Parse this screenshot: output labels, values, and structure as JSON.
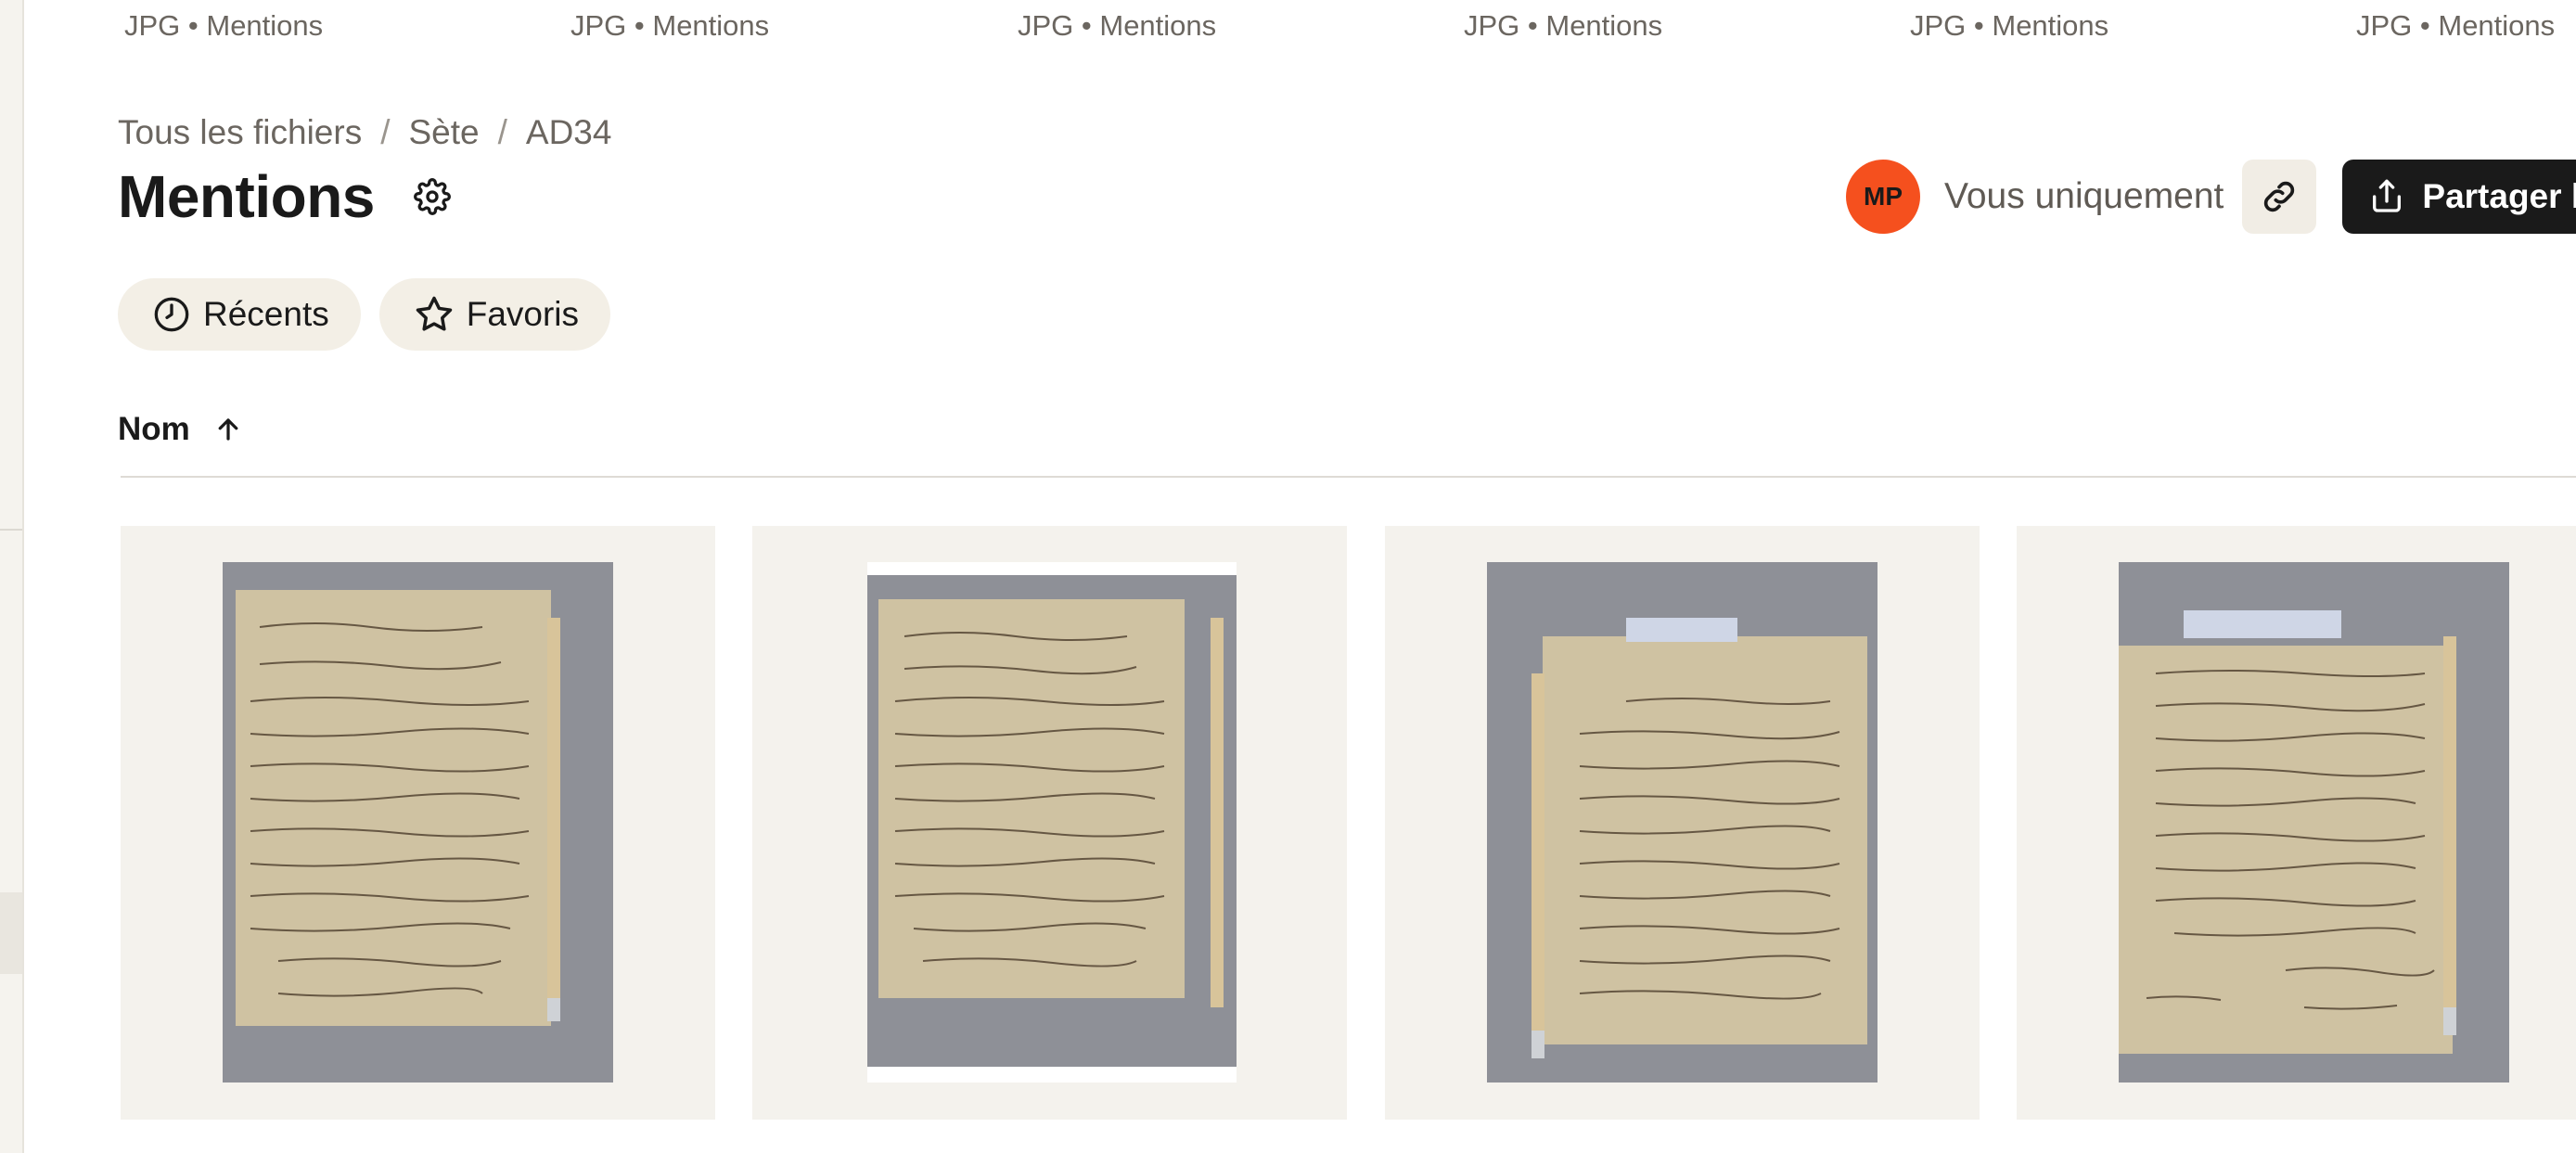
{
  "top_meta": [
    "JPG • Mentions",
    "JPG • Mentions",
    "JPG • Mentions",
    "JPG • Mentions",
    "JPG • Mentions",
    "JPG • Mentions"
  ],
  "breadcrumb": {
    "items": [
      "Tous les fichiers",
      "Sète",
      "AD34"
    ],
    "separator": "/"
  },
  "page": {
    "title": "Mentions"
  },
  "share": {
    "avatar_initials": "MP",
    "avatar_color": "#f5501e",
    "visibility_label": "Vous uniquement",
    "share_label": "Partager le"
  },
  "filters": [
    {
      "label": "Récents",
      "icon": "clock-icon"
    },
    {
      "label": "Favoris",
      "icon": "star-icon"
    }
  ],
  "sort": {
    "label": "Nom",
    "direction": "ascending"
  },
  "files": [
    {
      "type": "image",
      "icon": "handwritten-document-thumbnail"
    },
    {
      "type": "image",
      "icon": "handwritten-document-thumbnail"
    },
    {
      "type": "image",
      "icon": "handwritten-document-thumbnail"
    },
    {
      "type": "image",
      "icon": "handwritten-document-thumbnail"
    }
  ]
}
